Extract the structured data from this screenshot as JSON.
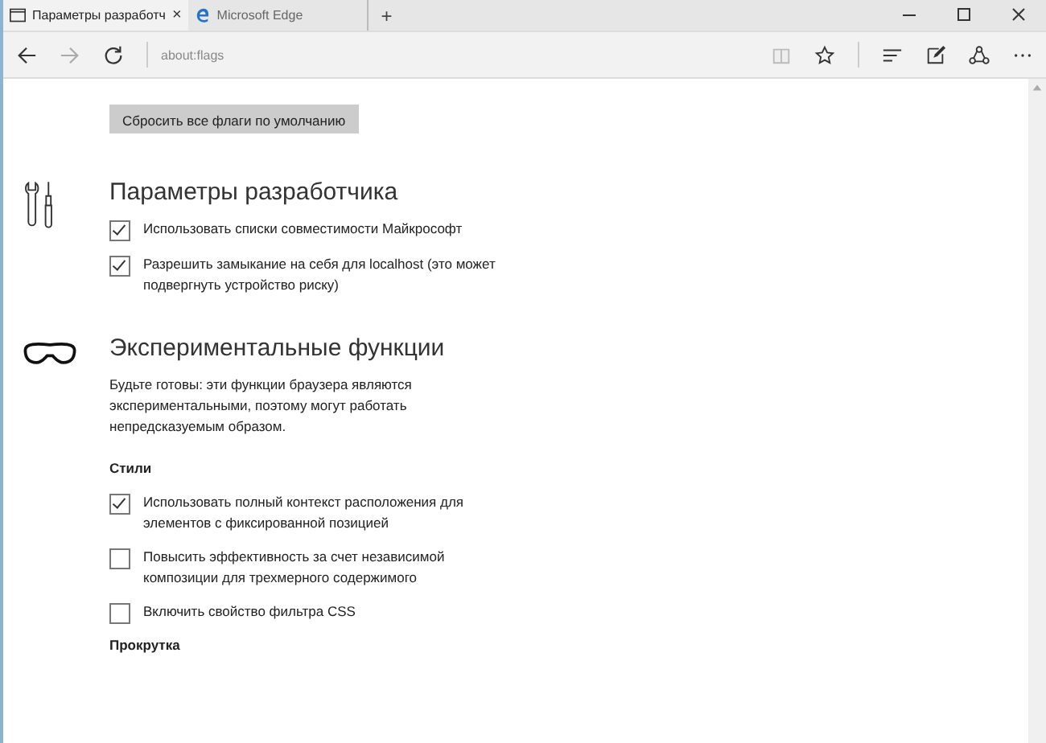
{
  "tabs": [
    {
      "title": "Параметры разработч",
      "selected": true,
      "kind": "page",
      "close": "×"
    },
    {
      "title": "Microsoft Edge",
      "selected": false,
      "kind": "edge"
    }
  ],
  "new_tab": "+",
  "address": "about:flags",
  "reset_button": "Сбросить все флаги по умолчанию",
  "sections": [
    {
      "kind": "tools",
      "title": "Параметры разработчика",
      "groups": [
        {
          "items": [
            {
              "label": "Использовать списки совместимости Майкрософт",
              "checked": true
            },
            {
              "label": "Разрешить замыкание на себя для localhost (это может подвергнуть устройство риску)",
              "checked": true
            }
          ]
        }
      ]
    },
    {
      "kind": "goggles",
      "title": "Экспериментальные функции",
      "description": "Будьте готовы: эти функции браузера являются экспериментальными, поэтому могут работать непредсказуемым образом.",
      "groups": [
        {
          "heading": "Стили",
          "items": [
            {
              "label": "Использовать полный контекст расположения для элементов с фиксированной позицией",
              "checked": true
            },
            {
              "label": "Повысить эффективность за счет независимой композиции для трехмерного содержимого",
              "checked": false
            },
            {
              "label": "Включить свойство фильтра CSS",
              "checked": false
            }
          ]
        },
        {
          "heading": "Прокрутка"
        }
      ]
    }
  ]
}
